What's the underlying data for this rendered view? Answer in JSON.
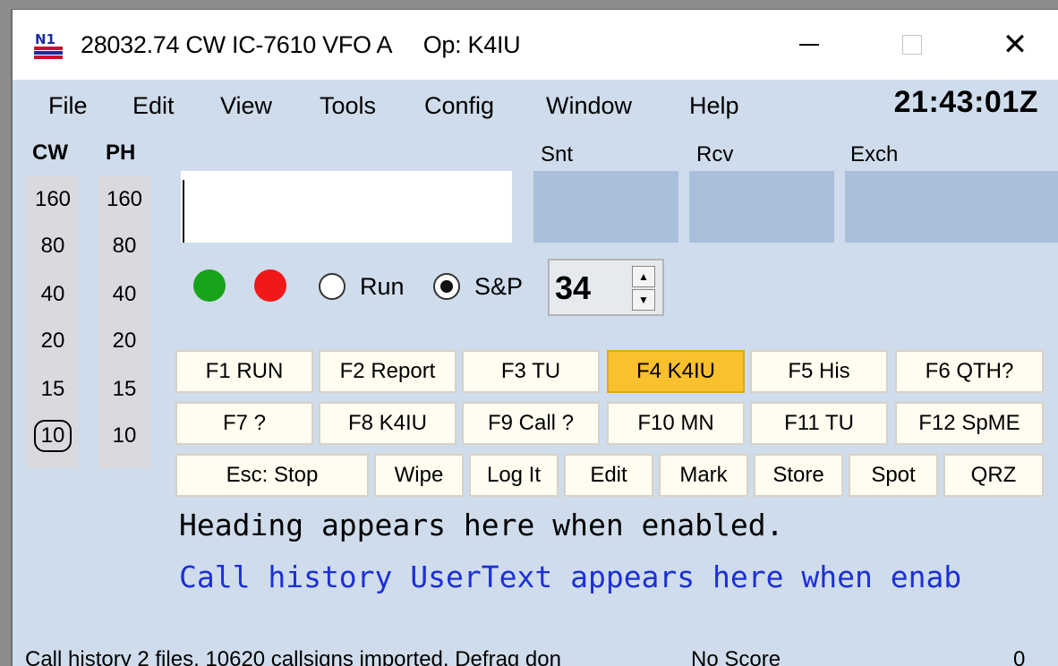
{
  "window": {
    "title": "28032.74 CW IC-7610 VFO A     Op: K4IU",
    "minimize_label": "—",
    "close_label": "✕"
  },
  "menu": [
    "File",
    "Edit",
    "View",
    "Tools",
    "Config",
    "Window",
    "Help"
  ],
  "clock": "21:43:01Z",
  "bands": {
    "cw_header": "CW",
    "ph_header": "PH",
    "cw": [
      "160",
      "80",
      "40",
      "20",
      "15",
      "10"
    ],
    "ph": [
      "160",
      "80",
      "40",
      "20",
      "15",
      "10"
    ],
    "selected_cw": "10"
  },
  "entry": {
    "call_value": "",
    "snt_label": "Snt",
    "rcv_label": "Rcv",
    "exch_label": "Exch"
  },
  "indicators": {
    "green": "#17a31a",
    "red": "#f01818"
  },
  "mode": {
    "run_label": "Run",
    "sp_label": "S&P",
    "selected": "S&P"
  },
  "spinner": {
    "value": "34",
    "up": "▲",
    "down": "▼"
  },
  "function_keys": {
    "row1": [
      "F1 RUN",
      "F2 Report",
      "F3 TU",
      "F4 K4IU",
      "F5 His",
      "F6 QTH?"
    ],
    "row2": [
      "F7 ?",
      "F8 K4IU",
      "F9 Call ?",
      "F10 MN",
      "F11 TU",
      "F12 SpME"
    ],
    "highlighted": "F4 K4IU"
  },
  "actions": [
    "Esc: Stop",
    "Wipe",
    "Log It",
    "Edit",
    "Mark",
    "Store",
    "Spot",
    "QRZ"
  ],
  "info": {
    "heading": "Heading appears here when enabled.",
    "history": "Call history UserText appears here when enab"
  },
  "status": {
    "message": "Call history 2 files, 10620 callsigns imported. Defrag don",
    "score": "No Score",
    "count": "0"
  },
  "colors": {
    "highlight": "#fbc02d",
    "history_text": "#1c30d6",
    "entry_fill": "#a9bfdb",
    "background": "#cfdceb"
  }
}
